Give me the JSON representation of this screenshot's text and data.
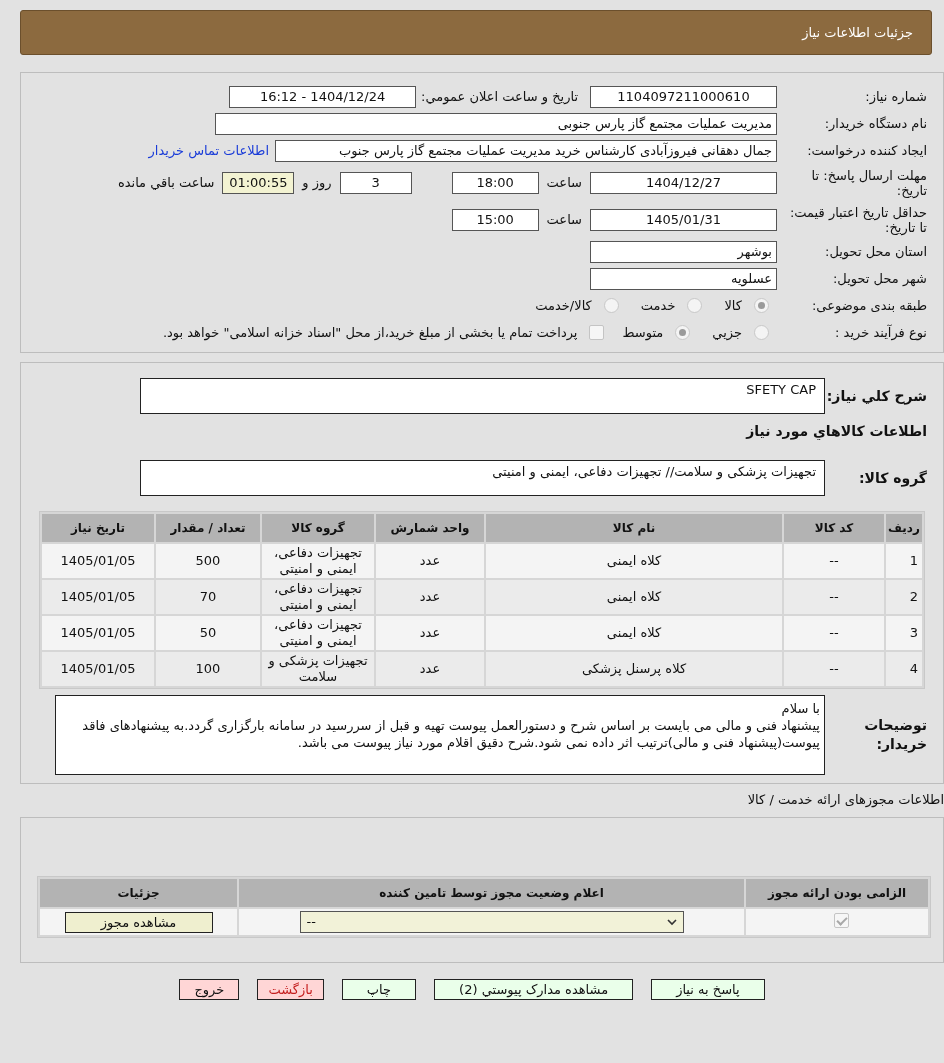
{
  "header": {
    "title": "جزئیات اطلاعات نیاز"
  },
  "form": {
    "need_number": {
      "label": "شماره نیاز:",
      "value": "1104097211000610"
    },
    "announce": {
      "label": "تاریخ و ساعت اعلان عمومي:",
      "value": "1404/12/24 - 16:12"
    },
    "buyer": {
      "label": "نام دستگاه خریدار:",
      "value": "مدیریت عملیات مجتمع گاز پارس جنوبی"
    },
    "creator": {
      "label": "ایجاد کننده درخواست:",
      "value": "جمال دهقانی فیروزآبادی کارشناس خرید مدیریت عملیات مجتمع گاز پارس جنوب",
      "link": "اطلاعات تماس خریدار"
    },
    "deadline": {
      "label": "مهلت ارسال پاسخ: تا تاریخ:",
      "date": "1404/12/27",
      "time_label": "ساعت",
      "time": "18:00",
      "days": "3",
      "days_label": "روز و",
      "remaining": "01:00:55",
      "remaining_label": "ساعت باقي مانده"
    },
    "validity": {
      "label": "حداقل تاریخ اعتبار قیمت: تا تاریخ:",
      "date": "1405/01/31",
      "time_label": "ساعت",
      "time": "15:00"
    },
    "province": {
      "label": "استان محل تحویل:",
      "value": "بوشهر"
    },
    "city": {
      "label": "شهر محل تحویل:",
      "value": "عسلویه"
    },
    "category": {
      "label": "طبقه بندی موضوعی:",
      "options": [
        {
          "label": "کالا",
          "selected": true
        },
        {
          "label": "خدمت",
          "selected": false
        },
        {
          "label": "کالا/خدمت",
          "selected": false
        }
      ]
    },
    "process": {
      "label": "نوع فرآیند خرید :",
      "options": [
        {
          "label": "جزيي",
          "selected": false
        },
        {
          "label": "متوسط",
          "selected": true
        }
      ],
      "payment": {
        "checked": false,
        "label": "پرداخت تمام یا بخشی از مبلغ خرید،از محل \"اسناد خزانه اسلامی\" خواهد بود."
      }
    }
  },
  "details": {
    "description": {
      "label": "شرح كلي نیاز:",
      "value": "SFETY CAP"
    },
    "goods_title": "اطلاعات كالاهاي مورد نیاز",
    "group": {
      "label": "گروه کالا:",
      "value": "تجهیزات پزشکی و سلامت// تجهیزات دفاعی، ایمنی و امنیتی"
    },
    "table": {
      "columns": [
        "ردیف",
        "کد کالا",
        "نام کالا",
        "واحد شمارش",
        "گروه کالا",
        "تعداد / مقدار",
        "تاریخ نیاز"
      ],
      "rows": [
        [
          "1",
          "--",
          "کلاه ایمنی",
          "عدد",
          "تجهیزات دفاعی، ایمنی و امنیتی",
          "500",
          "1405/01/05"
        ],
        [
          "2",
          "--",
          "کلاه ایمنی",
          "عدد",
          "تجهیزات دفاعی، ایمنی و امنیتی",
          "70",
          "1405/01/05"
        ],
        [
          "3",
          "--",
          "کلاه ایمنی",
          "عدد",
          "تجهیزات دفاعی، ایمنی و امنیتی",
          "50",
          "1405/01/05"
        ],
        [
          "4",
          "--",
          "کلاه پرسنل پزشکی",
          "عدد",
          "تجهیزات پزشکی و سلامت",
          "100",
          "1405/01/05"
        ]
      ]
    },
    "notes": {
      "label": "توضیحات خریدار:",
      "lines": [
        "با سلام",
        "پیشنهاد فنی و مالی می بایست بر اساس شرح و دستورالعمل پیوست تهیه و قبل از سررسید در سامانه بارگزاری گردد.به پیشنهادهای فاقد پیوست(پیشنهاد فنی و مالی)ترتیب اثر داده نمی شود.شرح دقیق اقلام مورد نیاز پیوست می باشد."
      ]
    }
  },
  "licenses": {
    "title": "اطلاعات مجوزهای ارائه خدمت / کالا",
    "columns": [
      "الزامی بودن ارائه مجوز",
      "اعلام وضعیت مجوز توسط تامین کننده",
      "جزئیات"
    ],
    "rows": [
      {
        "required": true,
        "status": "--",
        "button": "مشاهده مجوز"
      }
    ]
  },
  "buttons": [
    {
      "label": "پاسخ به نیاز",
      "kind": "primary"
    },
    {
      "label": "مشاهده مدارک پیوستي (2)",
      "kind": "primary"
    },
    {
      "label": "چاپ",
      "kind": "primary"
    },
    {
      "label": "بازگشت",
      "kind": "back"
    },
    {
      "label": "خروج",
      "kind": "exit"
    }
  ]
}
